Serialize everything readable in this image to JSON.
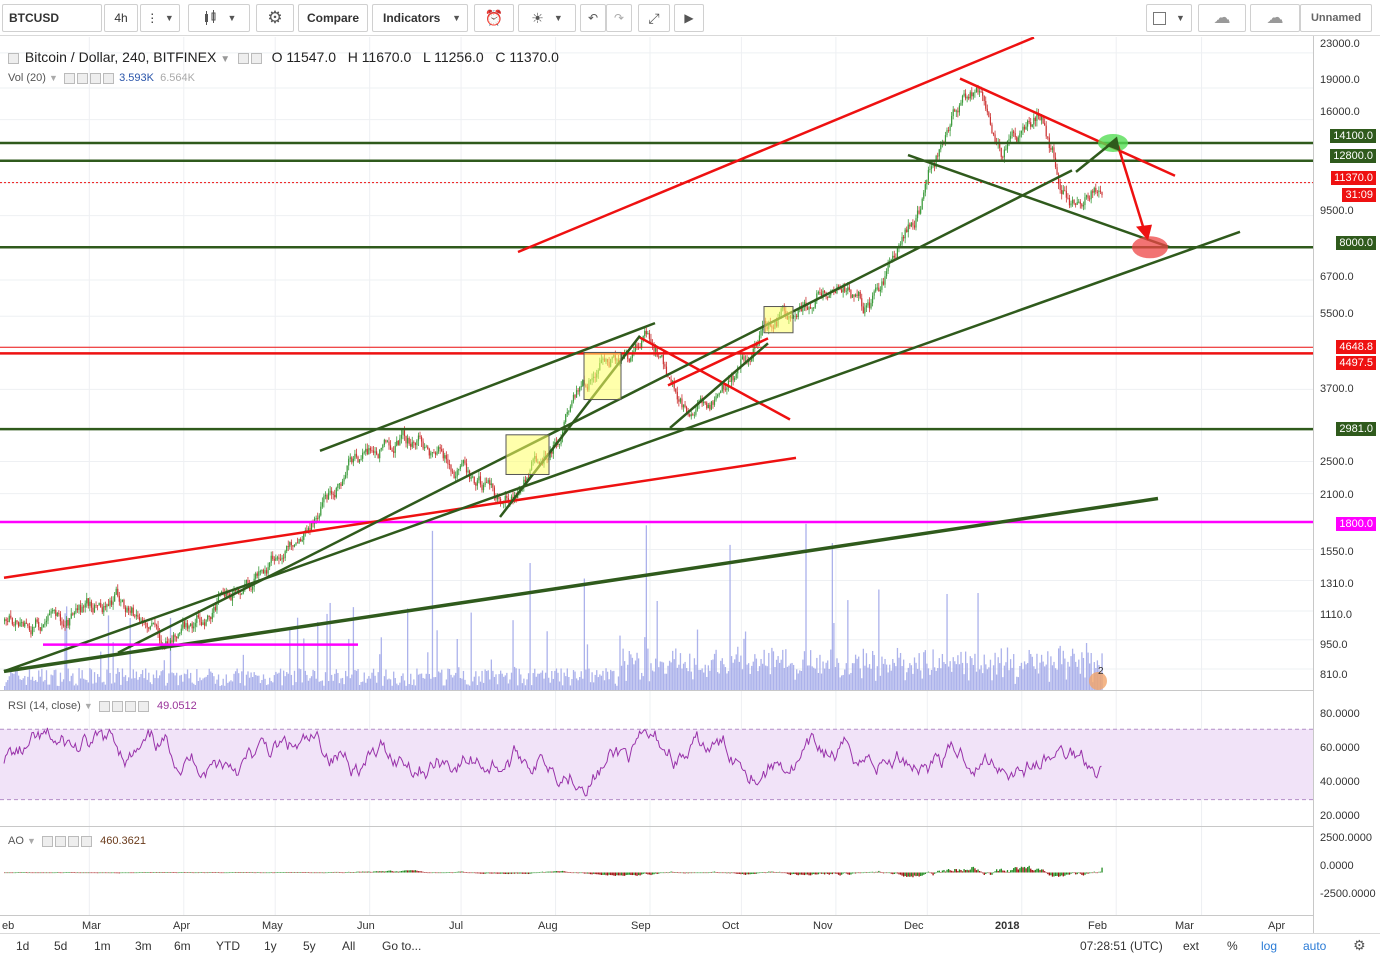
{
  "toolbar": {
    "symbol": "BTCUSD",
    "interval": "4h",
    "compare_label": "Compare",
    "indicators_label": "Indicators",
    "layout_name": "Unnamed"
  },
  "legend": {
    "title": "Bitcoin / Dollar, 240, BITFINEX",
    "open": "O 11547.0",
    "high": "H 11670.0",
    "low": "L 11256.0",
    "close": "C 11370.0",
    "vol_label": "Vol (20)",
    "vol_value": "3.593K",
    "vol_ma": "6.564K",
    "rsi_label": "RSI (14, close)",
    "rsi_value": "49.0512",
    "ao_label": "AO",
    "ao_value": "460.3621"
  },
  "price_axis": [
    "23000.0",
    "19000.0",
    "16000.0",
    "12800.0",
    "11370.0",
    "9500.0",
    "8000.0",
    "6700.0",
    "5500.0",
    "4648.8",
    "4497.5",
    "3700.0",
    "2500.0",
    "2100.0",
    "1800.0",
    "1550.0",
    "1310.0",
    "1110.0",
    "950.0",
    "810.0"
  ],
  "price_tags": {
    "level_14100": "14100.0",
    "level_12800": "12800.0",
    "last": "11370.0",
    "countdown": "31:09",
    "level_8000": "8000.0",
    "level_4648": "4648.8",
    "level_4497": "4497.5",
    "level_2981": "2981.0",
    "level_1800": "1800.0"
  },
  "rsi_axis": [
    "80.0000",
    "60.0000",
    "40.0000",
    "20.0000"
  ],
  "ao_axis": [
    "2500.0000",
    "0.0000",
    "-2500.0000"
  ],
  "time_axis": [
    "eb",
    "Mar",
    "Apr",
    "May",
    "Jun",
    "Jul",
    "Aug",
    "Sep",
    "Oct",
    "Nov",
    "Dec",
    "2018",
    "Feb",
    "Mar",
    "Apr"
  ],
  "bottom": {
    "ranges": [
      "1d",
      "5d",
      "1m",
      "3m",
      "6m",
      "YTD",
      "1y",
      "5y",
      "All"
    ],
    "goto": "Go to...",
    "clock": "07:28:51 (UTC)",
    "ext": "ext",
    "percent": "%",
    "log": "log",
    "auto": "auto"
  },
  "colors": {
    "support_green": "#2f5a1c",
    "resistance_red": "#ee1111",
    "magenta": "#ff00ff",
    "rsi_line": "#9933aa",
    "volume": "#9ea4e8",
    "candle_up": "#3a9a3a",
    "candle_down": "#cc3333",
    "accent_blue": "#2a7bd6"
  },
  "chart_data": {
    "type": "candlestick",
    "symbol": "BTCUSD",
    "exchange": "BITFINEX",
    "timeframe": "240",
    "scale": "log",
    "ylim": [
      780,
      24000
    ],
    "x_range": [
      "2017-02",
      "2018-04"
    ],
    "last": {
      "open": 11547.0,
      "high": 11670.0,
      "low": 11256.0,
      "close": 11370.0
    },
    "approx_monthly_close": [
      {
        "x": "2017-02-20",
        "y": 1050
      },
      {
        "x": "2017-03-10",
        "y": 1200
      },
      {
        "x": "2017-03-25",
        "y": 950
      },
      {
        "x": "2017-04-15",
        "y": 1180
      },
      {
        "x": "2017-05-10",
        "y": 1700
      },
      {
        "x": "2017-05-25",
        "y": 2500
      },
      {
        "x": "2017-06-10",
        "y": 2900
      },
      {
        "x": "2017-06-25",
        "y": 2550
      },
      {
        "x": "2017-07-15",
        "y": 1950
      },
      {
        "x": "2017-07-30",
        "y": 2750
      },
      {
        "x": "2017-08-15",
        "y": 4200
      },
      {
        "x": "2017-09-01",
        "y": 4800
      },
      {
        "x": "2017-09-15",
        "y": 3000
      },
      {
        "x": "2017-10-01",
        "y": 4300
      },
      {
        "x": "2017-10-15",
        "y": 5600
      },
      {
        "x": "2017-11-01",
        "y": 6600
      },
      {
        "x": "2017-11-12",
        "y": 5700
      },
      {
        "x": "2017-11-28",
        "y": 9800
      },
      {
        "x": "2017-12-08",
        "y": 16000
      },
      {
        "x": "2017-12-17",
        "y": 19400
      },
      {
        "x": "2017-12-25",
        "y": 13500
      },
      {
        "x": "2018-01-07",
        "y": 16500
      },
      {
        "x": "2018-01-17",
        "y": 10000
      },
      {
        "x": "2018-01-28",
        "y": 11370
      }
    ],
    "horizontal_levels": [
      14100.0,
      12800.0,
      8000.0,
      4648.8,
      4497.5,
      2981.0,
      1800.0
    ],
    "rsi": {
      "period": 14,
      "source": "close",
      "last": 49.0512,
      "ylim": [
        15,
        90
      ],
      "bands": [
        70,
        30
      ]
    },
    "ao": {
      "last": 460.3621,
      "ylim": [
        -4000,
        4000
      ]
    },
    "volume": {
      "period": 20,
      "last": "3.593K",
      "ma": "6.564K"
    }
  }
}
